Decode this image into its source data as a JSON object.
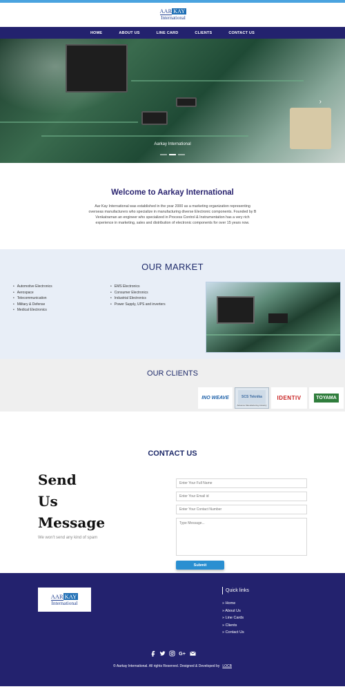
{
  "header": {
    "logo_top_left": "AAR",
    "logo_top_right": "KAY",
    "logo_bottom": "International"
  },
  "nav": {
    "items": [
      "HOME",
      "ABOUT US",
      "LINE CARD",
      "CLIENTS",
      "CONTACT US"
    ]
  },
  "hero": {
    "caption": "Aarkay International",
    "next_arrow": "›",
    "slide_count": 3,
    "active_slide": 2
  },
  "welcome": {
    "title": "Welcome to Aarkay International",
    "body": "Aar Kay International was established in the year 2000 as a marketing organization representing overseas manufacturers who specialize in manufacturing diverse Electronic components. Founded by B Venkatraman an engineer who specialized in Process Control & Instrumentation has a very rich experience in marketing, sales and distribution of electronic components for over 15 years now."
  },
  "market": {
    "title": "OUR MARKET",
    "col1": [
      "Automotive Electronics",
      "Aerospace",
      "Telecommunication",
      "Military & Defense",
      "Medical Electronics"
    ],
    "col2": [
      "EMS Electronics",
      "Consumer Electronics",
      "Industrial Electronics",
      "Power Supply, UPS and inverters"
    ]
  },
  "clients": {
    "title": "OUR CLIENTS",
    "logos": [
      "INO WEAVE",
      "SCS Teknika",
      "IDENTIV",
      "TOYAMA"
    ],
    "scs_sub": "Advance Manufacturing Industry"
  },
  "contact": {
    "title": "CONTACT US",
    "send_lines": [
      "Send",
      "Us",
      "Message"
    ],
    "spam_note": "We won't send any kind of spam",
    "name_placeholder": "Enter Your Full Name",
    "email_placeholder": "Enter Your Email id",
    "number_placeholder": "Enter Your Contact Number",
    "message_placeholder": "Type Message...",
    "submit_label": "Submit"
  },
  "footer": {
    "quick_links_title": "Quick links",
    "quick_links": [
      "» Home",
      "» About Us",
      "» Line Cards",
      "» Clients",
      "» Contact Us"
    ],
    "social_icons": [
      "facebook-icon",
      "twitter-icon",
      "instagram-icon",
      "google-plus-icon",
      "mail-icon"
    ],
    "copyright": "© Aarkay International. All rights Reserved. Designed & Developed by",
    "developer": "LOCB"
  },
  "colors": {
    "nav_bg": "#23226e",
    "accent": "#2a8fd1",
    "title": "#2a2470"
  }
}
